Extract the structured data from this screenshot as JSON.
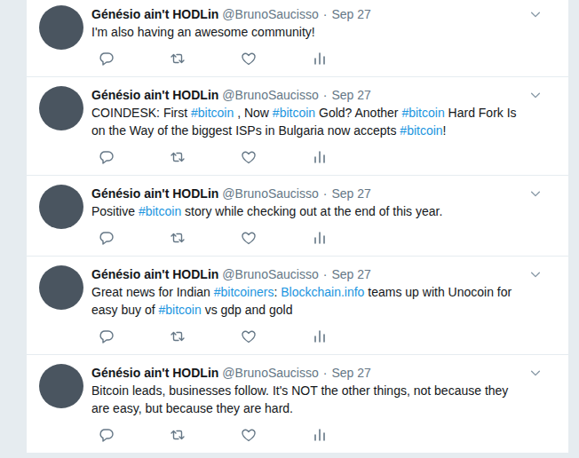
{
  "tweets": [
    {
      "name": "Génésio ain't HODLin",
      "handle": "@BrunoSaucisso",
      "separator": "·",
      "date": "Sep 27",
      "segments": [
        {
          "text": "I'm also having an awesome community!",
          "kind": "text"
        }
      ]
    },
    {
      "name": "Génésio ain't HODLin",
      "handle": "@BrunoSaucisso",
      "separator": "·",
      "date": "Sep 27",
      "segments": [
        {
          "text": "COINDESK: First ",
          "kind": "text"
        },
        {
          "text": "#bitcoin",
          "kind": "hashtag"
        },
        {
          "text": " , Now ",
          "kind": "text"
        },
        {
          "text": "#bitcoin",
          "kind": "hashtag"
        },
        {
          "text": " Gold? Another ",
          "kind": "text"
        },
        {
          "text": "#bitcoin",
          "kind": "hashtag"
        },
        {
          "text": " Hard Fork Is on the Way of the biggest ISPs in Bulgaria now accepts ",
          "kind": "text"
        },
        {
          "text": "#bitcoin",
          "kind": "hashtag"
        },
        {
          "text": "!",
          "kind": "text"
        }
      ]
    },
    {
      "name": "Génésio ain't HODLin",
      "handle": "@BrunoSaucisso",
      "separator": "·",
      "date": "Sep 27",
      "segments": [
        {
          "text": "Positive ",
          "kind": "text"
        },
        {
          "text": "#bitcoin",
          "kind": "hashtag"
        },
        {
          "text": " story while checking out at the end of this year.",
          "kind": "text"
        }
      ]
    },
    {
      "name": "Génésio ain't HODLin",
      "handle": "@BrunoSaucisso",
      "separator": "·",
      "date": "Sep 27",
      "segments": [
        {
          "text": "Great news for Indian ",
          "kind": "text"
        },
        {
          "text": "#bitcoiners",
          "kind": "hashtag"
        },
        {
          "text": ": ",
          "kind": "text"
        },
        {
          "text": "Blockchain.info",
          "kind": "link"
        },
        {
          "text": " teams up with Unocoin for easy buy of ",
          "kind": "text"
        },
        {
          "text": "#bitcoin",
          "kind": "hashtag"
        },
        {
          "text": " vs gdp and gold",
          "kind": "text"
        }
      ]
    },
    {
      "name": "Génésio ain't HODLin",
      "handle": "@BrunoSaucisso",
      "separator": "·",
      "date": "Sep 27",
      "segments": [
        {
          "text": "Bitcoin leads, businesses follow. It's NOT the other things, not because they are easy, but because they are hard.",
          "kind": "text"
        }
      ]
    }
  ]
}
